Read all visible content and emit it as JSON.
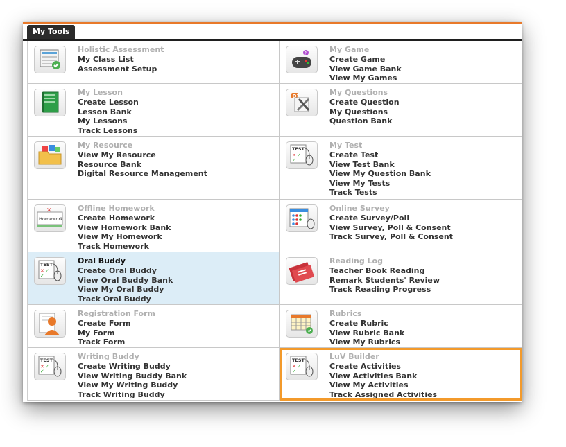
{
  "tabs": {
    "active": "My Tools"
  },
  "colors": {
    "accent_orange": "#e8792a",
    "highlight_outline": "#f39a2b",
    "active_cell_bg": "#dcedf7"
  },
  "tools": [
    {
      "title": "Holistic Assessment",
      "icon": "class-list-icon",
      "links": [
        "My Class List",
        "Assessment Setup"
      ]
    },
    {
      "title": "My Game",
      "icon": "gamepad-icon",
      "links": [
        "Create Game",
        "View Game Bank",
        "View My Games"
      ]
    },
    {
      "title": "My Lesson",
      "icon": "lesson-book-icon",
      "links": [
        "Create Lesson",
        "Lesson Bank",
        "My Lessons",
        "Track Lessons"
      ]
    },
    {
      "title": "My Questions",
      "icon": "question-tools-icon",
      "links": [
        "Create Question",
        "My Questions",
        "Question Bank"
      ]
    },
    {
      "title": "My Resource",
      "icon": "resource-folder-icon",
      "links": [
        "View My Resource",
        "Resource Bank",
        "Digital Resource Management"
      ]
    },
    {
      "title": "My Test",
      "icon": "test-icon",
      "links": [
        "Create Test",
        "View Test Bank",
        "View My Question Bank",
        "View My Tests",
        "Track Tests"
      ]
    },
    {
      "title": "Offline Homework",
      "icon": "homework-icon",
      "links": [
        "Create Homework",
        "View Homework Bank",
        "View My Homework",
        "Track Homework"
      ]
    },
    {
      "title": "Online Survey",
      "icon": "survey-icon",
      "links": [
        "Create Survey/Poll",
        "View Survey, Poll & Consent",
        "Track Survey, Poll & Consent"
      ]
    },
    {
      "title": "Oral Buddy",
      "icon": "test-icon",
      "links": [
        "Create Oral Buddy",
        "View Oral Buddy Bank",
        "View My Oral Buddy",
        "Track Oral Buddy"
      ]
    },
    {
      "title": "Reading Log",
      "icon": "reading-book-icon",
      "links": [
        "Teacher Book Reading",
        "Remark Students' Review",
        "Track Reading Progress"
      ]
    },
    {
      "title": "Registration Form",
      "icon": "registration-person-icon",
      "links": [
        "Create Form",
        "My Form",
        "Track Form"
      ]
    },
    {
      "title": "Rubrics",
      "icon": "rubric-grid-icon",
      "links": [
        "Create Rubric",
        "View Rubric Bank",
        "View My Rubrics"
      ]
    },
    {
      "title": "Writing Buddy",
      "icon": "test-icon",
      "links": [
        "Create Writing Buddy",
        "View Writing Buddy Bank",
        "View My Writing Buddy",
        "Track Writing Buddy"
      ]
    },
    {
      "title": "LuV Builder",
      "icon": "test-icon",
      "links": [
        "Create Activities",
        "View Activities Bank",
        "View My Activities",
        "Track Assigned Activities"
      ]
    }
  ]
}
